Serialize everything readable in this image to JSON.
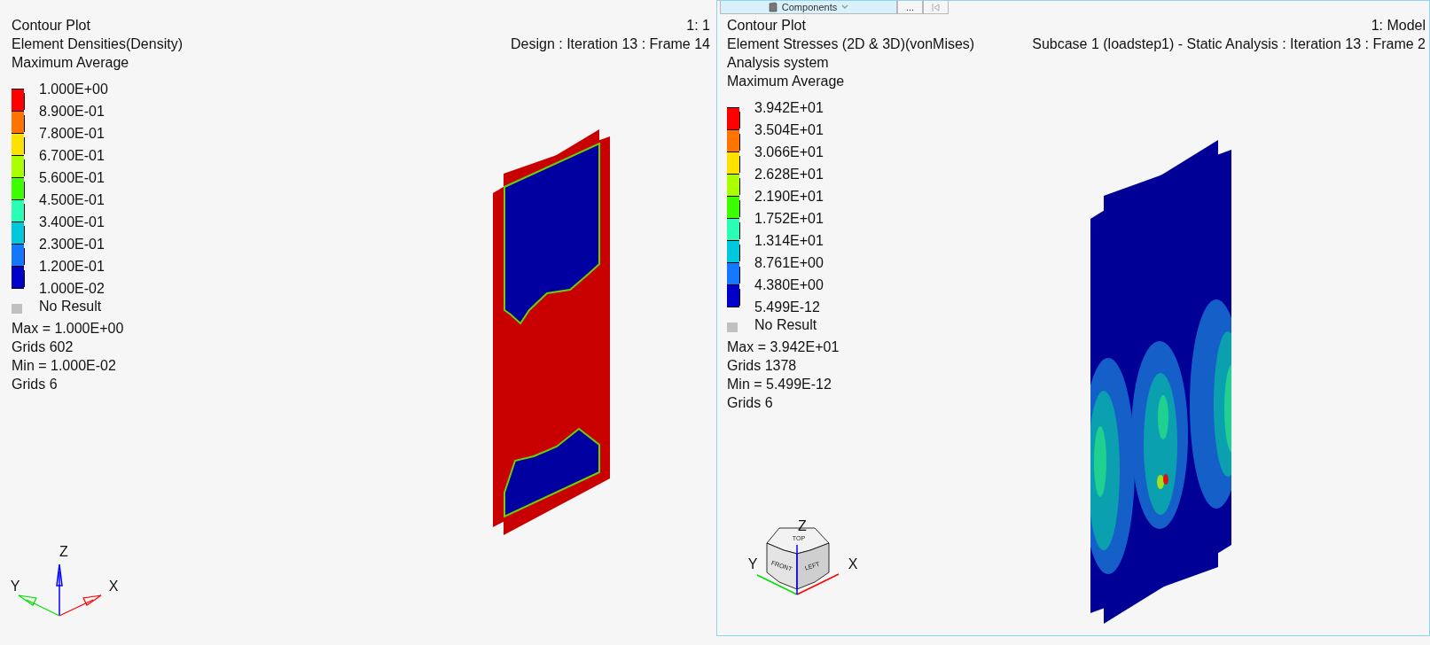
{
  "viewports": [
    {
      "kind": "density",
      "legend": {
        "title_lines": [
          "Contour Plot",
          "Element Densities(Density)",
          "Maximum Average"
        ],
        "levels": [
          "1.000E+00",
          "8.900E-01",
          "7.800E-01",
          "6.700E-01",
          "5.600E-01",
          "4.500E-01",
          "3.400E-01",
          "2.300E-01",
          "1.200E-01",
          "1.000E-02"
        ],
        "bands": [
          {
            "color": "#ff0000"
          },
          {
            "color": "#ff7300"
          },
          {
            "color": "#ffe100"
          },
          {
            "color": "#aaff00"
          },
          {
            "color": "#3cff00"
          },
          {
            "color": "#28ffb4"
          },
          {
            "color": "#00c8dc"
          },
          {
            "color": "#1478ff"
          },
          {
            "color": "#0000c8"
          }
        ],
        "no_result": "No Result",
        "stats": [
          "Max =  1.000E+00",
          "Grids 602",
          "Min =  1.000E-02",
          "Grids 6"
        ]
      },
      "info": [
        "1: 1",
        "Design : Iteration 13 : Frame 14"
      ],
      "triad": {
        "kind": "axes",
        "x": "X",
        "y": "Y",
        "z": "Z"
      }
    },
    {
      "kind": "stress",
      "toolbar": [
        {
          "kind": "dropdown",
          "label": "Components"
        },
        {
          "kind": "text",
          "label": "..."
        },
        {
          "kind": "icon"
        }
      ],
      "legend": {
        "title_lines": [
          "Contour Plot",
          "Element Stresses (2D & 3D)(vonMises)",
          "Analysis system",
          "Maximum Average"
        ],
        "levels": [
          "3.942E+01",
          "3.504E+01",
          "3.066E+01",
          "2.628E+01",
          "2.190E+01",
          "1.752E+01",
          "1.314E+01",
          "8.761E+00",
          "4.380E+00",
          "5.499E-12"
        ],
        "bands": [
          {
            "color": "#ff0000"
          },
          {
            "color": "#ff7300"
          },
          {
            "color": "#ffe100"
          },
          {
            "color": "#aaff00"
          },
          {
            "color": "#3cff00"
          },
          {
            "color": "#28ffb4"
          },
          {
            "color": "#00c8dc"
          },
          {
            "color": "#1478ff"
          },
          {
            "color": "#0000c8"
          }
        ],
        "no_result": "No Result",
        "stats": [
          "Max =  3.942E+01",
          "Grids 1378",
          "Min =  5.499E-12",
          "Grids 6"
        ]
      },
      "info": [
        "1: Model",
        "Subcase 1 (loadstep1) - Static Analysis : Iteration 13 : Frame 2"
      ],
      "triad": {
        "kind": "cube",
        "x": "X",
        "y": "Y",
        "z": "Z",
        "faces": [
          "TOP",
          "FRONT",
          "LEFT"
        ]
      }
    }
  ]
}
